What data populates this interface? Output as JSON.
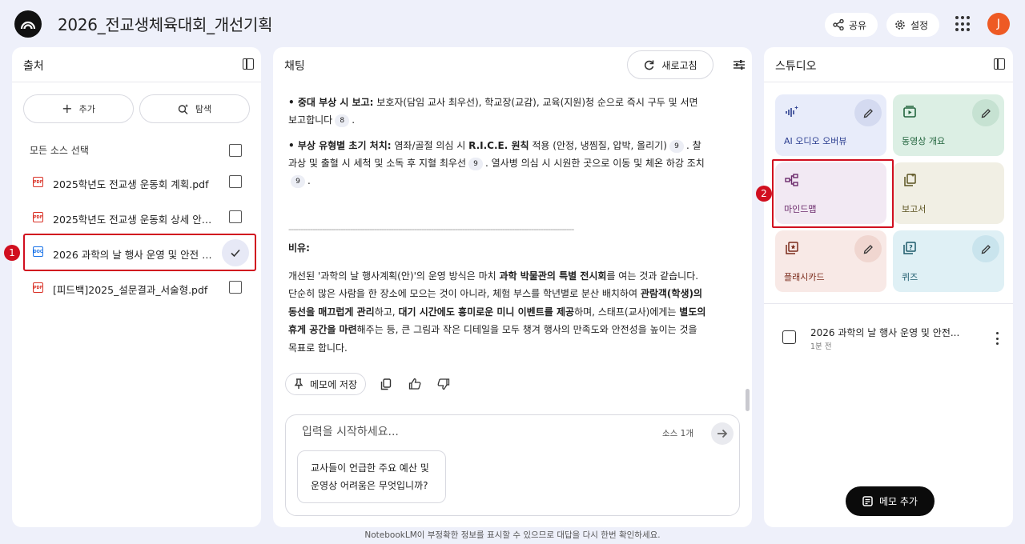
{
  "app": {
    "title": "2026_전교생체육대회_개선기획",
    "share_label": "공유",
    "settings_label": "설정",
    "avatar_letter": "J"
  },
  "sources": {
    "title": "출처",
    "add_label": "추가",
    "explore_label": "탐색",
    "select_all_label": "모든 소스 선택",
    "items": [
      {
        "label": "2025학년도 전교생 운동회 계획.pdf",
        "type": "PDF",
        "checked": false
      },
      {
        "label": "2025학년도 전교생 운동회 상세 안전 ...",
        "type": "PDF",
        "checked": false
      },
      {
        "label": "2026 과학의 날 행사 운영 및 안전 계획",
        "type": "DOC",
        "checked": true
      },
      {
        "label": "[피드백]2025_설문결과_서술형.pdf",
        "type": "PDF",
        "checked": false
      }
    ]
  },
  "markers": {
    "one": "1",
    "two": "2"
  },
  "chat": {
    "title": "채팅",
    "refresh_label": "새로고침",
    "p1_bold": "• 중대 부상 시 보고:",
    "p1_text": " 보호자(담임 교사 최우선), 학교장(교감), 교육(지원)청 순으로 즉시 구두 및 서면 보고합니다",
    "p1_cite": "8",
    "p2_bold": "• 부상 유형별 초기 처치:",
    "p2_text_a": " 염좌/골절 의심 시 ",
    "p2_bold2": "R.I.C.E. 원칙",
    "p2_text_b": " 적용 (안정, 냉찜질, 압박, 올리기)",
    "p2_cite1": "9",
    "p2_text_c": ". 찰과상 및 출혈 시 세척 및 소독 후 지혈 최우선",
    "p2_cite2": "9",
    "p2_text_d": ". 열사병 의심 시 시원한 곳으로 이동 및 체온 하강 조치",
    "p2_cite3": "9",
    "divider": "------------------------------------------------------------------------------------------------------------------------",
    "analogy_title": "비유:",
    "a_t1": "개선된 '과학의 날 행사계획(안)'의 운영 방식은 마치 ",
    "a_b1": "과학 박물관의 특별 전시회",
    "a_t2": "를 여는 것과 같습니다. 단순히 많은 사람을 한 장소에 모으는 것이 아니라, 체험 부스를 학년별로 분산 배치하여 ",
    "a_b2": "관람객(학생)의 동선을 매끄럽게 관리",
    "a_t3": "하고, ",
    "a_b3": "대기 시간에도 흥미로운 미니 이벤트를 제공",
    "a_t4": "하며, 스태프(교사)에게는 ",
    "a_b4": "별도의 휴게 공간을 마련",
    "a_t5": "해주는 등, 큰 그림과 작은 디테일을 모두 챙겨 행사의 만족도와 안전성을 높이는 것을 목표로 합니다.",
    "save_memo_label": "메모에 저장",
    "input_placeholder": "입력을 시작하세요...",
    "source_count": "소스 1개",
    "suggestion": "교사들이 언급한 주요 예산 및 운영상 어려움은 무엇입니까?"
  },
  "studio": {
    "title": "스튜디오",
    "tiles": [
      {
        "label": "AI 오디오 오버뷰"
      },
      {
        "label": "동영상 개요"
      },
      {
        "label": "마인드맵"
      },
      {
        "label": "보고서"
      },
      {
        "label": "플래시카드"
      },
      {
        "label": "퀴즈"
      }
    ],
    "note_title": "2026 과학의 날 행사 운영 및 안전...",
    "note_time": "1분 전",
    "add_memo_label": "메모 추가"
  },
  "footer": "NotebookLM이 부정확한 정보를 표시할 수 있으므로 대답을 다시 한번 확인하세요.",
  "colors": {
    "background": "#eef0fa",
    "highlight": "#d10f1f",
    "avatar": "#ee5a24"
  }
}
